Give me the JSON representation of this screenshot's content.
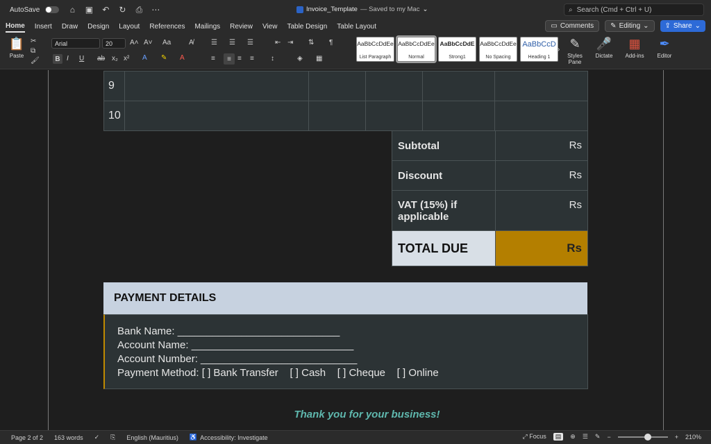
{
  "titlebar": {
    "autosave_label": "AutoSave",
    "doc_name": "Invoice_Template",
    "saved_status": "— Saved to my Mac",
    "search_placeholder": "Search (Cmd + Ctrl + U)"
  },
  "tabs": [
    {
      "label": "Home",
      "active": true
    },
    {
      "label": "Insert"
    },
    {
      "label": "Draw"
    },
    {
      "label": "Design"
    },
    {
      "label": "Layout"
    },
    {
      "label": "References"
    },
    {
      "label": "Mailings"
    },
    {
      "label": "Review"
    },
    {
      "label": "View"
    },
    {
      "label": "Table Design"
    },
    {
      "label": "Table Layout"
    }
  ],
  "header_actions": {
    "comments": "Comments",
    "editing": "Editing",
    "share": "Share"
  },
  "ribbon": {
    "paste": "Paste",
    "font_name": "Arial",
    "font_size": "20",
    "styles": [
      {
        "preview": "AaBbCcDdEe",
        "name": "List Paragraph"
      },
      {
        "preview": "AaBbCcDdEe",
        "name": "Normal",
        "selected": true
      },
      {
        "preview": "AaBbCcDdE",
        "name": "Strong1"
      },
      {
        "preview": "AaBbCcDdEe",
        "name": "No Spacing"
      },
      {
        "preview": "AaBbCcD",
        "name": "Heading 1"
      }
    ],
    "styles_pane": "Styles Pane",
    "dictate": "Dictate",
    "addins": "Add-ins",
    "editor": "Editor"
  },
  "document": {
    "rows": [
      "9",
      "10"
    ],
    "summary": [
      {
        "label": "Subtotal",
        "value": "Rs"
      },
      {
        "label": "Discount",
        "value": "Rs"
      },
      {
        "label": "VAT (15%) if applicable",
        "value": "Rs"
      }
    ],
    "total": {
      "label": "TOTAL DUE",
      "value": "Rs"
    },
    "payment_title": "PAYMENT DETAILS",
    "payment_lines": [
      "Bank Name: ____________________________",
      "Account Name: ____________________________",
      "Account Number: ___________________________",
      "Payment Method: [ ] Bank Transfer    [ ] Cash    [ ] Cheque    [ ] Online"
    ],
    "thanks": "Thank you for your business!"
  },
  "statusbar": {
    "page": "Page 2 of 2",
    "words": "163 words",
    "language": "English (Mauritius)",
    "accessibility": "Accessibility: Investigate",
    "focus": "Focus",
    "zoom": "210%"
  },
  "colors": {
    "accent_total": "#b47f00",
    "payment_header": "#c7d2e0",
    "thanks_text": "#5fb8ae",
    "share_button": "#2d6ad7"
  }
}
